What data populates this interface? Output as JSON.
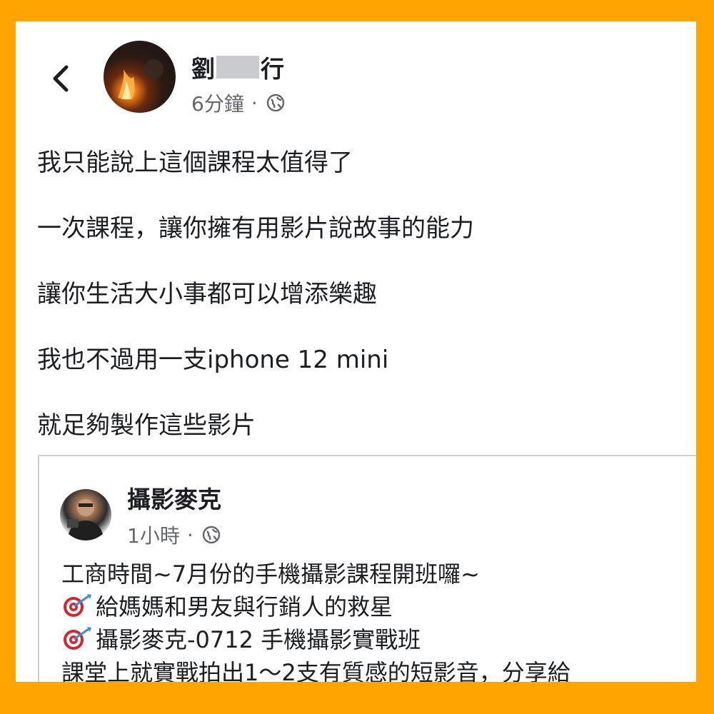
{
  "author": {
    "name_start": "劉",
    "name_end": "行",
    "time": "6分鐘",
    "separator": "·",
    "audience_icon": "globe-icon"
  },
  "post_lines": [
    "我只能說上這個課程太值得了",
    "一次課程，讓你擁有用影片說故事的能力",
    "讓你生活大小事都可以增添樂趣",
    "我也不過用一支iphone 12 mini",
    "就足夠製作這些影片"
  ],
  "shared_post": {
    "name": "攝影麥克",
    "time": "1小時",
    "separator": "·",
    "lines": [
      "工商時間~7月份的手機攝影課程開班囉~",
      "給媽媽和男友與行銷人的救星",
      "攝影麥克-0712 手機攝影實戰班",
      "課堂上就實戰拍出1～2支有質感的短影音，分享給"
    ],
    "bullet_icon": "dart-target-icon"
  },
  "colors": {
    "frame": "#FFA400",
    "text": "#1c1e21",
    "secondary": "#65676b"
  }
}
